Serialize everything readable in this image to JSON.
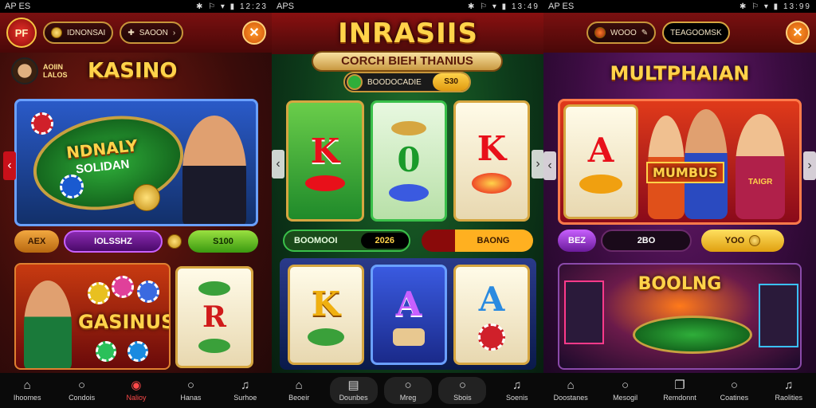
{
  "colors": {
    "brand_red": "#b01010",
    "gold": "#ffd34a",
    "green": "#2fae3a",
    "purple": "#6a1a6e",
    "orange": "#ff9a2a"
  },
  "screens": [
    {
      "status": {
        "left": "AP ES",
        "time": "12:23"
      },
      "topbar": {
        "logo": "PF",
        "balance": "IDNONSAI",
        "wallet": "SAOON"
      },
      "section_title": "KASINO",
      "section_sub": "AOIIN LALOS",
      "banner": {
        "title": "NDNALY",
        "subtitle": "SOLIDAN"
      },
      "stats": {
        "a": "AEX",
        "b": "IOLSSHZ",
        "c": "S100"
      },
      "promo_title": "GASINUS",
      "nav": [
        {
          "icon": "home-icon",
          "label": "Ihoomes"
        },
        {
          "icon": "search-icon",
          "label": "Condois"
        },
        {
          "icon": "games-icon",
          "label": "Nalioy"
        },
        {
          "icon": "search-icon",
          "label": "Hanas"
        },
        {
          "icon": "bell-icon",
          "label": "Surhoe"
        }
      ]
    },
    {
      "status": {
        "left": "APS",
        "time": "13:49"
      },
      "header": {
        "title": "INRASIIS",
        "subtitle": "CORCH BIEH THANIUS"
      },
      "balance": {
        "label": "BOODOCADIE",
        "value": "S30"
      },
      "reels_top": [
        {
          "symbol": "K"
        },
        {
          "symbol": "0"
        },
        {
          "symbol": "K"
        }
      ],
      "stats": {
        "a": "BOOMOOI",
        "b": "2026",
        "c": "BAONG"
      },
      "reels_bottom": [
        {
          "symbol": "K"
        },
        {
          "symbol": "A"
        },
        {
          "symbol": "A"
        }
      ],
      "nav": [
        {
          "icon": "home-icon",
          "label": "Beoeir"
        },
        {
          "icon": "doc-icon",
          "label": "Dounbes"
        },
        {
          "icon": "search-icon",
          "label": "Mreg"
        },
        {
          "icon": "search-icon",
          "label": "Sbois"
        },
        {
          "icon": "bell-icon",
          "label": "Soenis"
        }
      ]
    },
    {
      "status": {
        "left": "AP ES",
        "time": "13:99"
      },
      "topbar": {
        "balance": "WOOO",
        "wallet": "TEAGOOMSK"
      },
      "section_title": "MULTPHAIAN",
      "reel_symbol": "A",
      "banner_label": "MUMBUS",
      "side_label": "TAIGR",
      "stats": {
        "a": "BEZ",
        "b": "2BO",
        "c": "YOO"
      },
      "promo_title": "BOOLNG",
      "nav": [
        {
          "icon": "home-icon",
          "label": "Doostanes"
        },
        {
          "icon": "search-icon",
          "label": "Mesogil"
        },
        {
          "icon": "book-icon",
          "label": "Remdonnt"
        },
        {
          "icon": "search-icon",
          "label": "Coatines"
        },
        {
          "icon": "bell-icon",
          "label": "Raolities"
        }
      ]
    }
  ]
}
